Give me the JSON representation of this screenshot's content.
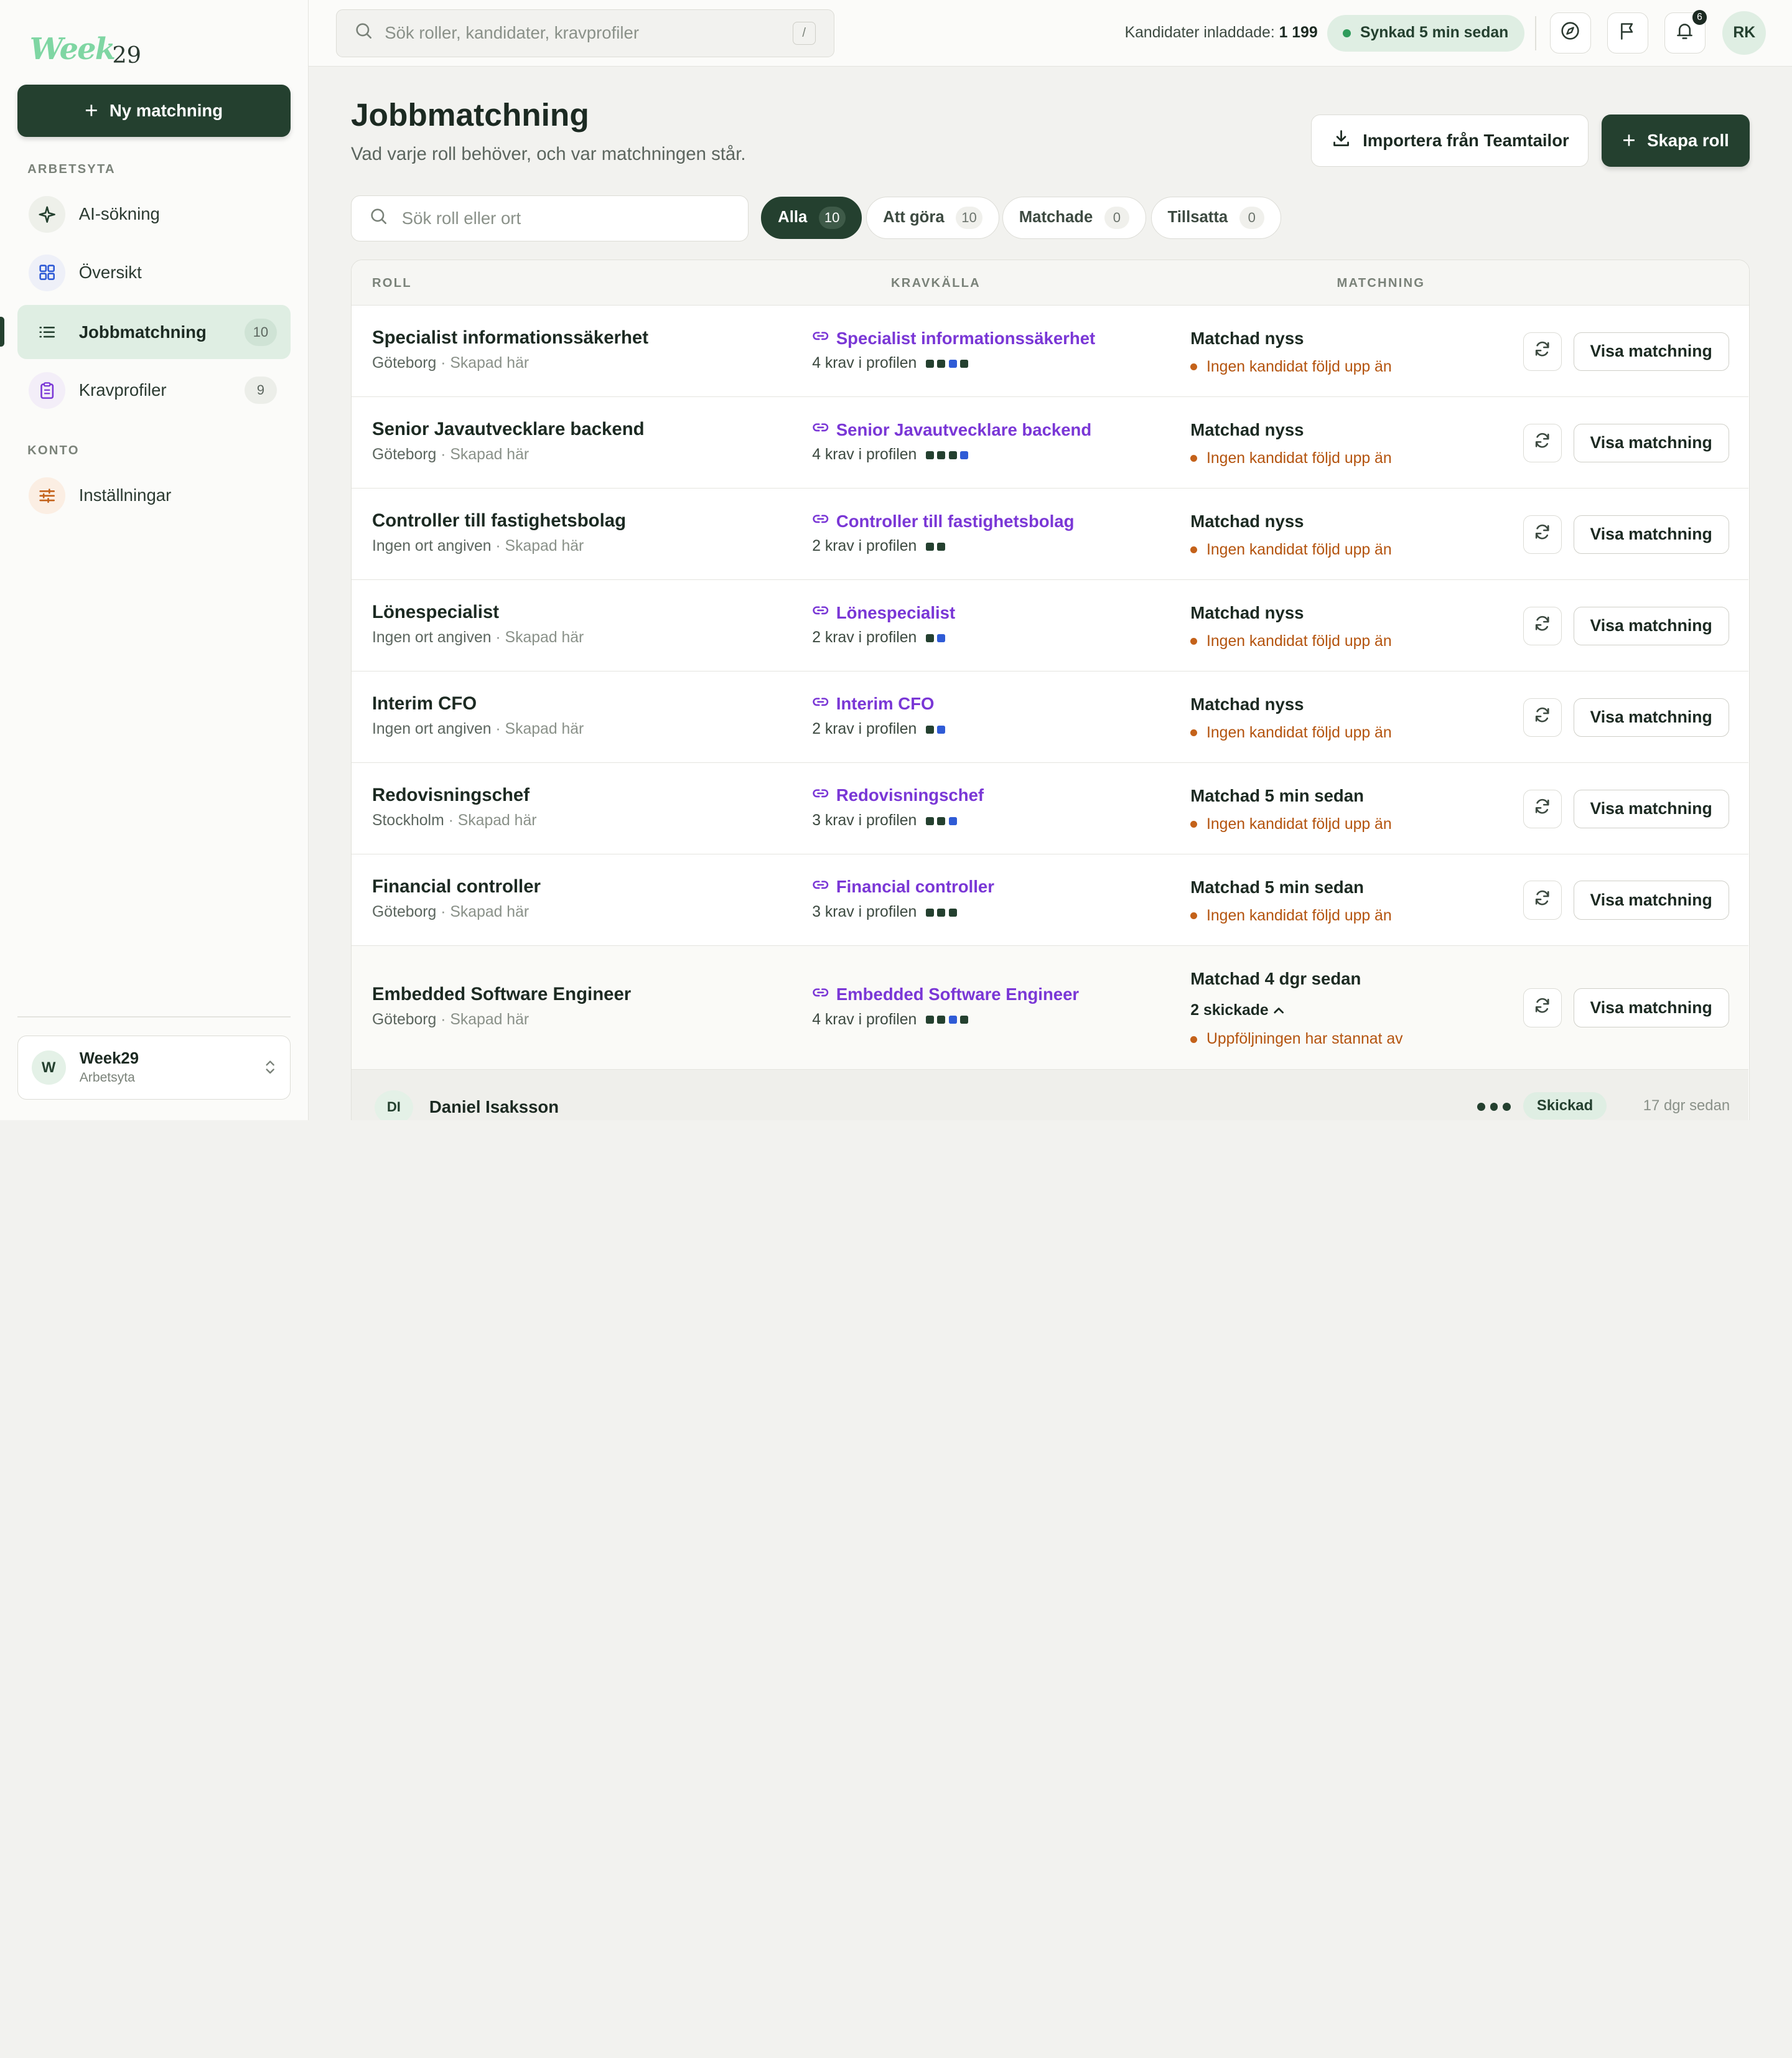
{
  "sidebar": {
    "logo_word": "Week",
    "logo_num": "29",
    "new_button": "Ny matchning",
    "section_workspace": "ARBETSYTA",
    "section_account": "KONTO",
    "items": [
      {
        "label": "AI-sökning",
        "count": ""
      },
      {
        "label": "Översikt",
        "count": ""
      },
      {
        "label": "Jobbmatchning",
        "count": "10"
      },
      {
        "label": "Kravprofiler",
        "count": "9"
      },
      {
        "label": "Inställningar",
        "count": ""
      }
    ],
    "workspace": {
      "avatar": "W",
      "name": "Week29",
      "sub": "Arbetsyta"
    }
  },
  "topbar": {
    "search_placeholder": "Sök roller, kandidater, kravprofiler",
    "search_shortcut": "/",
    "stat_label": "Kandidater inladdade:",
    "stat_value": "1 199",
    "sync_label": "Synkad 5 min sedan",
    "notifications": "6",
    "user_initials": "RK"
  },
  "main": {
    "title": "Jobbmatchning",
    "subtitle": "Vad varje roll behöver, och var matchningen står.",
    "import_button": "Importera från Teamtailor",
    "create_button": "Skapa roll",
    "role_search_placeholder": "Sök roll eller ort",
    "filters": [
      {
        "label": "Alla",
        "count": "10"
      },
      {
        "label": "Att göra",
        "count": "10"
      },
      {
        "label": "Matchade",
        "count": "0"
      },
      {
        "label": "Tillsatta",
        "count": "0"
      }
    ],
    "columns": {
      "role": "ROLL",
      "source": "KRAVKÄLLA",
      "match": "MATCHNING"
    },
    "view_button": "Visa matchning",
    "rows": [
      {
        "title": "Specialist informationssäkerhet",
        "location": "Göteborg",
        "created": "· Skapad här",
        "source": "Specialist informationssäkerhet",
        "krav": "4 krav i profilen",
        "match": "Matchad nyss",
        "status": "Ingen kandidat följd upp än"
      },
      {
        "title": "Senior Javautvecklare backend",
        "location": "Göteborg",
        "created": "· Skapad här",
        "source": "Senior Javautvecklare backend",
        "krav": "4 krav i profilen",
        "match": "Matchad nyss",
        "status": "Ingen kandidat följd upp än"
      },
      {
        "title": "Controller till fastighetsbolag",
        "location": "Ingen ort angiven",
        "created": "· Skapad här",
        "source": "Controller till fastighetsbolag",
        "krav": "2 krav i profilen",
        "match": "Matchad nyss",
        "status": "Ingen kandidat följd upp än"
      },
      {
        "title": "Lönespecialist",
        "location": "Ingen ort angiven",
        "created": "· Skapad här",
        "source": "Lönespecialist",
        "krav": "2 krav i profilen",
        "match": "Matchad nyss",
        "status": "Ingen kandidat följd upp än"
      },
      {
        "title": "Interim CFO",
        "location": "Ingen ort angiven",
        "created": "· Skapad här",
        "source": "Interim CFO",
        "krav": "2 krav i profilen",
        "match": "Matchad nyss",
        "status": "Ingen kandidat följd upp än"
      },
      {
        "title": "Redovisningschef",
        "location": "Stockholm",
        "created": "· Skapad här",
        "source": "Redovisningschef",
        "krav": "3 krav i profilen",
        "match": "Matchad 5 min sedan",
        "status": "Ingen kandidat följd upp än"
      },
      {
        "title": "Financial controller",
        "location": "Göteborg",
        "created": "· Skapad här",
        "source": "Financial controller",
        "krav": "3 krav i profilen",
        "match": "Matchad 5 min sedan",
        "status": "Ingen kandidat följd upp än"
      },
      {
        "title": "Embedded Software Engineer",
        "location": "Göteborg",
        "created": "· Skapad här",
        "source": "Embedded Software Engineer",
        "krav": "4 krav i profilen",
        "match": "Matchad 4 dgr sedan",
        "sent": "2 skickade",
        "status": "Uppföljningen har stannat av"
      }
    ],
    "candidate": {
      "initials": "DI",
      "name": "Daniel Isaksson",
      "status": "Skickad",
      "time": "17 dgr sedan"
    }
  },
  "colors": {
    "brand": "#24402f",
    "accent_link": "#7a37d6",
    "warning": "#b4540f",
    "success_bg": "#dfeee3"
  }
}
